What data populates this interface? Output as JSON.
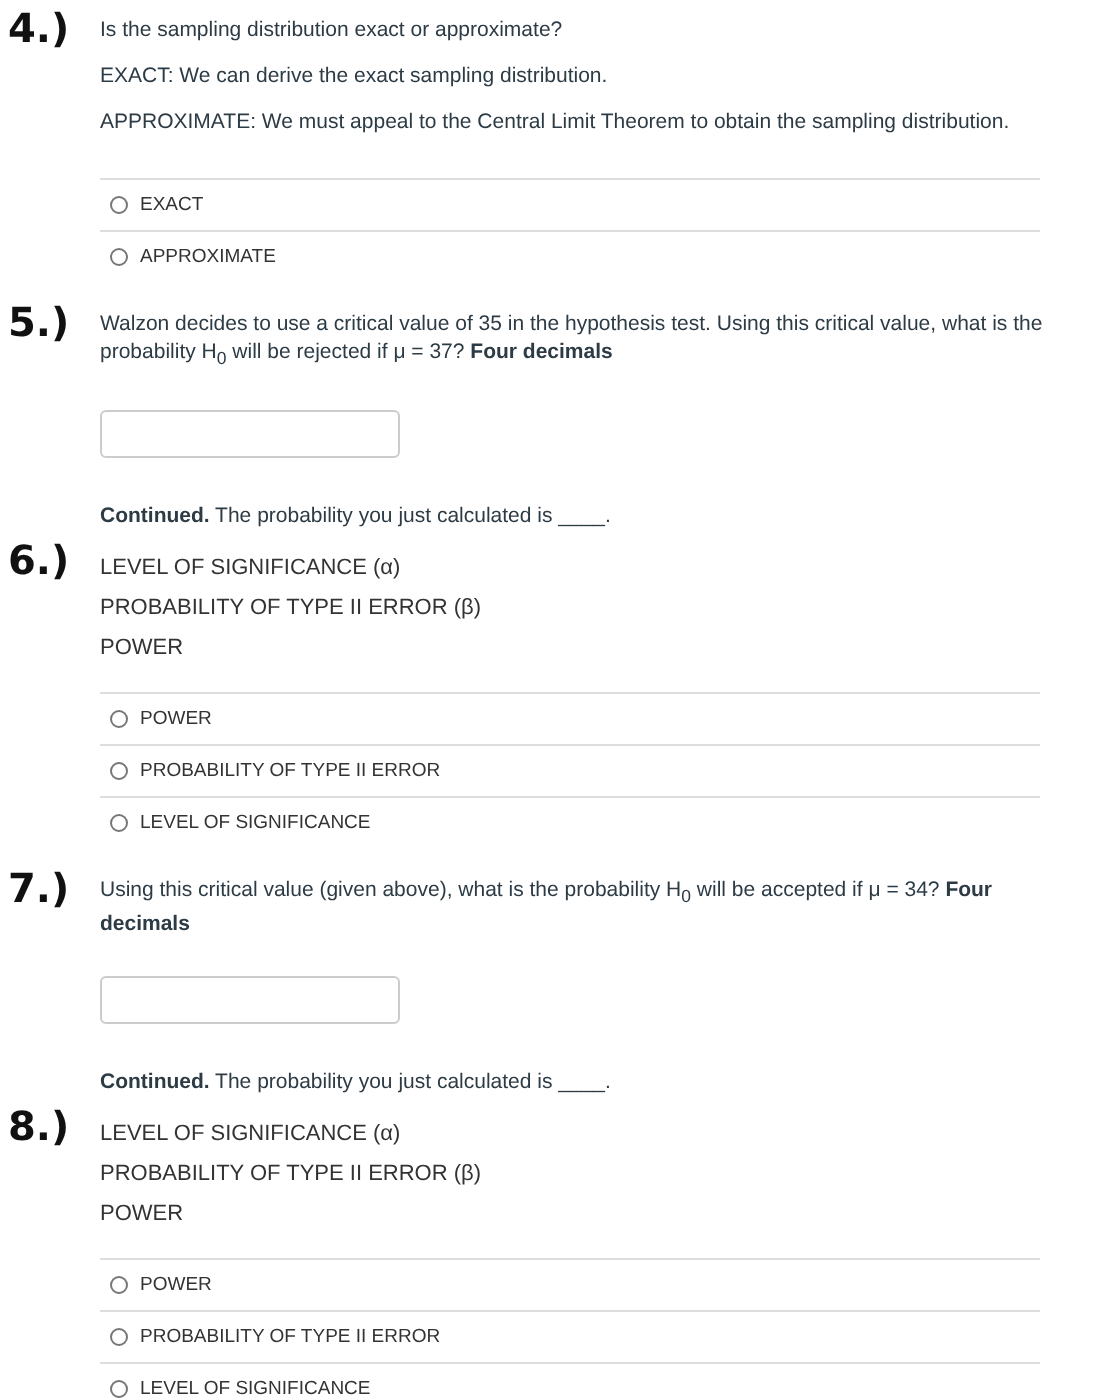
{
  "questions": [
    {
      "number": "4.)",
      "kind": "choice",
      "prompt": [
        "Is the sampling distribution exact or approximate?",
        "EXACT:  We can derive the exact sampling distribution.",
        "APPROXIMATE:  We must appeal to the Central Limit Theorem to obtain the sampling distribution."
      ],
      "options": [
        {
          "label": "EXACT",
          "selected": false
        },
        {
          "label": "APPROXIMATE",
          "selected": false
        }
      ]
    },
    {
      "number": "5.)",
      "kind": "numeric",
      "prompt": [
        "Walzon decides to use a critical value of 35 in the hypothesis test.  Using this critical value, what is the probability H$_{0}$ will be rejected if μ = 37?  **Four decimals**"
      ]
    },
    {
      "number": "6.)",
      "kind": "choice",
      "prompt": [
        "**Continued.**  The probability you just calculated is ____."
      ],
      "terms": [
        "LEVEL OF SIGNIFICANCE (α)",
        "PROBABILITY OF TYPE II ERROR (β)",
        "POWER"
      ],
      "options": [
        {
          "label": "POWER",
          "selected": false
        },
        {
          "label": "PROBABILITY OF TYPE II ERROR",
          "selected": false
        },
        {
          "label": "LEVEL OF SIGNIFICANCE",
          "selected": false
        }
      ]
    },
    {
      "number": "7.)",
      "kind": "numeric",
      "prompt": [
        "Using this critical value (given above), what is the probability H$_{0}$ will be accepted if μ = 34?  **Four decimals**"
      ]
    },
    {
      "number": "8.)",
      "kind": "choice",
      "prompt": [
        "**Continued.**  The probability you just calculated is ____."
      ],
      "terms": [
        "LEVEL OF SIGNIFICANCE (α)",
        "PROBABILITY OF TYPE II ERROR (β)",
        "POWER"
      ],
      "options": [
        {
          "label": "POWER",
          "selected": false
        },
        {
          "label": "PROBABILITY OF TYPE II ERROR",
          "selected": false
        },
        {
          "label": "LEVEL OF SIGNIFICANCE",
          "selected": false
        }
      ]
    }
  ]
}
